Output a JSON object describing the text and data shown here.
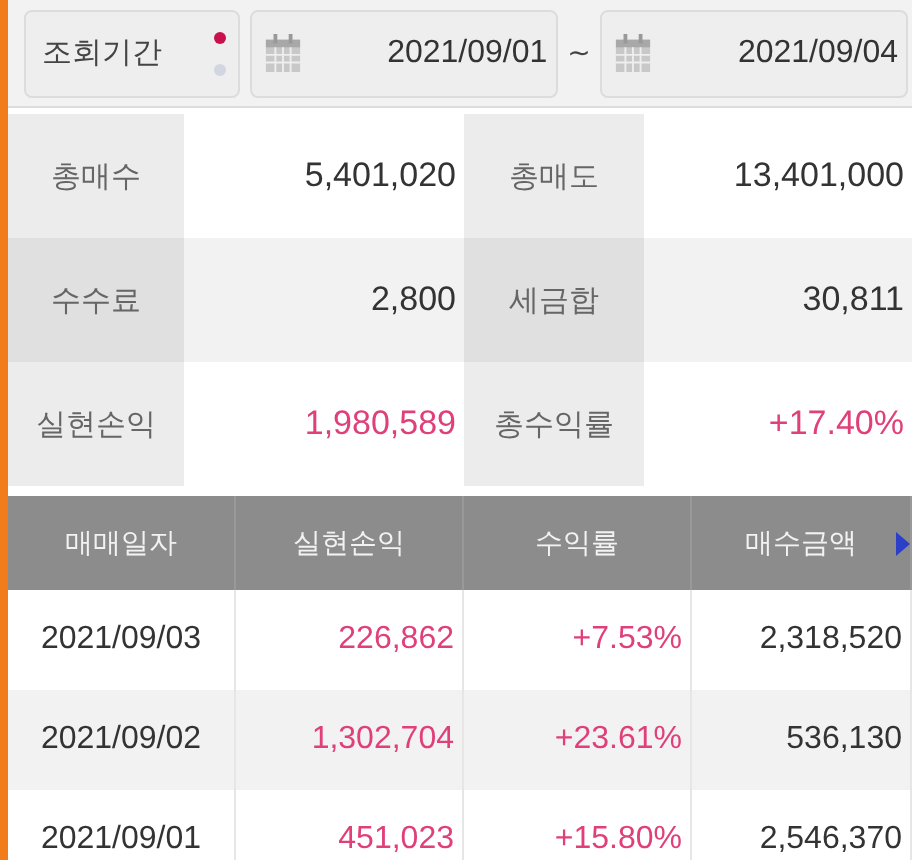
{
  "period": {
    "label": "조회기간",
    "pages": [
      {
        "selected": true
      },
      {
        "selected": false
      }
    ],
    "start_date": "2021/09/01",
    "separator": "~",
    "end_date": "2021/09/04"
  },
  "summary": [
    {
      "label": "총매수",
      "value": "5,401,020",
      "positive": false
    },
    {
      "label": "총매도",
      "value": "13,401,000",
      "positive": false
    },
    {
      "label": "수수료",
      "value": "2,800",
      "positive": false
    },
    {
      "label": "세금합",
      "value": "30,811",
      "positive": false
    },
    {
      "label": "실현손익",
      "value": "1,980,589",
      "positive": true
    },
    {
      "label": "총수익률",
      "value": "+17.40%",
      "positive": true
    }
  ],
  "table": {
    "columns": [
      "매매일자",
      "실현손익",
      "수익률",
      "매수금액"
    ],
    "rows": [
      {
        "date": "2021/09/03",
        "profit": "226,862",
        "rate": "+7.53%",
        "buy_amount": "2,318,520",
        "positive": true
      },
      {
        "date": "2021/09/02",
        "profit": "1,302,704",
        "rate": "+23.61%",
        "buy_amount": "536,130",
        "positive": true
      },
      {
        "date": "2021/09/01",
        "profit": "451,023",
        "rate": "+15.80%",
        "buy_amount": "2,546,370",
        "positive": true
      }
    ]
  }
}
